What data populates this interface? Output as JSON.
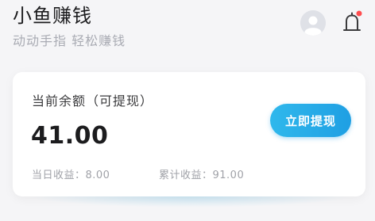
{
  "header": {
    "title": "小鱼赚钱",
    "subtitle": "动动手指 轻松赚钱"
  },
  "icons": {
    "avatar": "user-avatar-icon",
    "bell": "bell-icon",
    "bell_dot_color": "#ff4d4f"
  },
  "balance_card": {
    "label": "当前余额（可提现）",
    "amount": "41.00",
    "withdraw_label": "立即提现",
    "today_earnings": "当日收益：8.00",
    "total_earnings": "累计收益：91.00"
  },
  "colors": {
    "accent": "#1f9fe3",
    "background": "#f5f5f7"
  }
}
